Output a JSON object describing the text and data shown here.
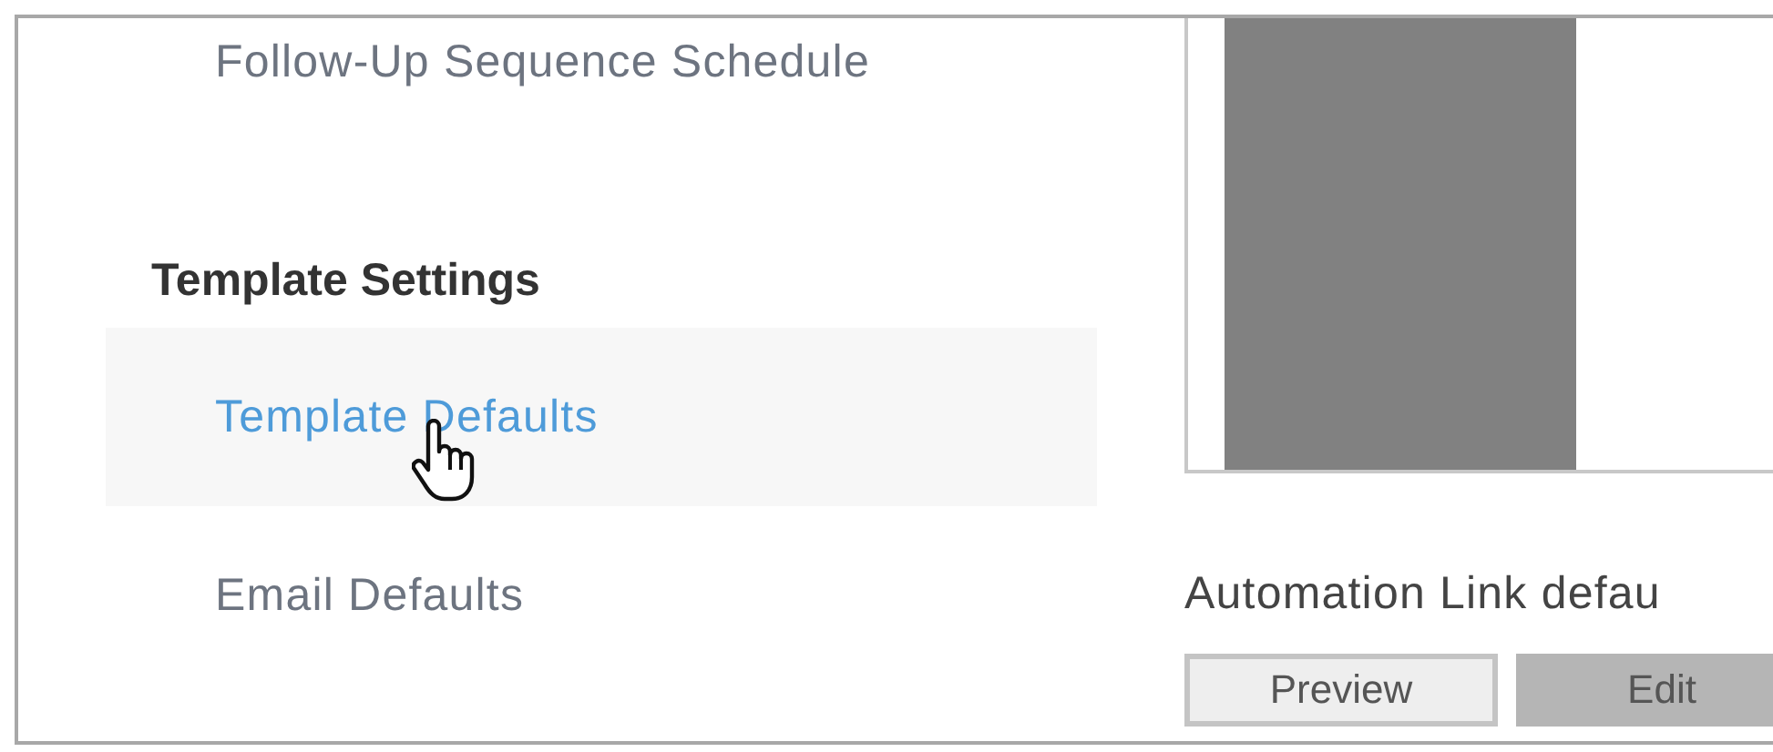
{
  "sidebar": {
    "items": [
      {
        "kind": "link",
        "label": "Follow-Up Sequence Schedule",
        "selected": false
      },
      {
        "kind": "heading",
        "label": "Template Settings"
      },
      {
        "kind": "link",
        "label": "Template Defaults",
        "selected": true
      },
      {
        "kind": "link",
        "label": "Email Defaults",
        "selected": false
      }
    ]
  },
  "content": {
    "section_label": "Automation Link defau",
    "buttons": [
      {
        "label": "Preview",
        "kind": "secondary"
      },
      {
        "label": "Edit",
        "kind": "primary"
      }
    ]
  }
}
